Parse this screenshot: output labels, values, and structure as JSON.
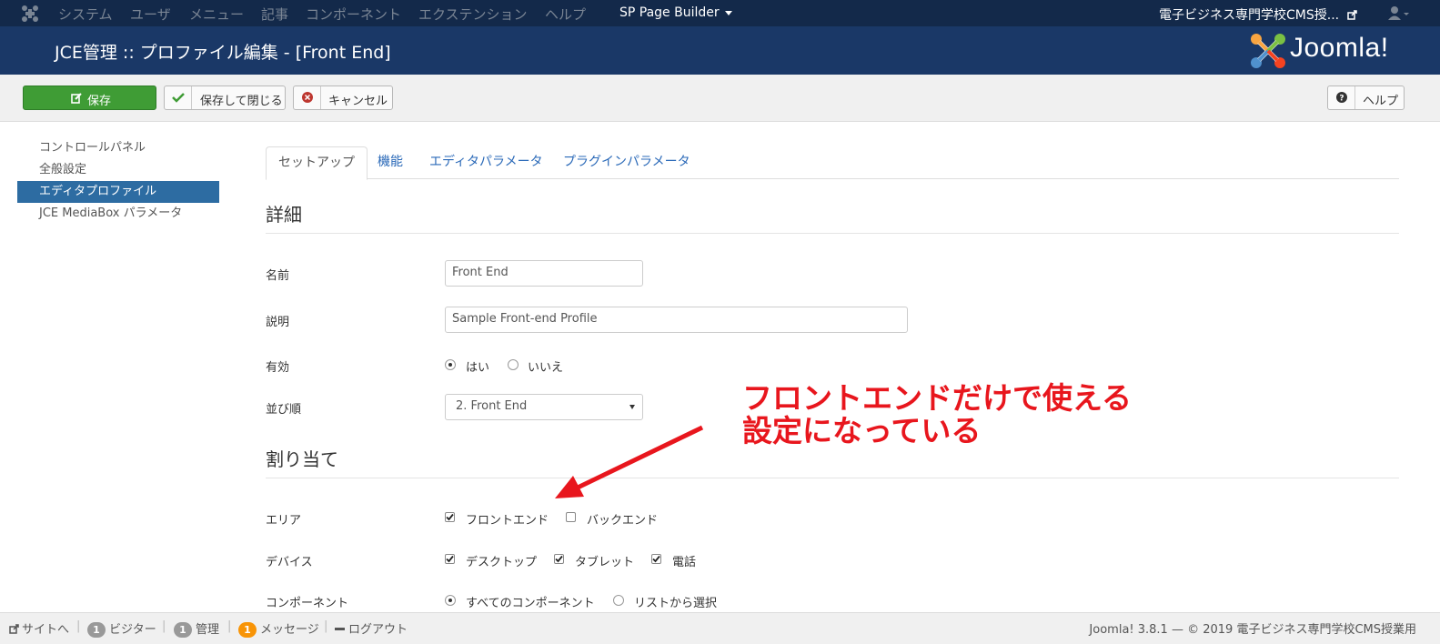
{
  "topnav": {
    "menu": [
      "システム",
      "ユーザ",
      "メニュー",
      "記事",
      "コンポーネント",
      "エクステンション",
      "ヘルプ"
    ],
    "page_builder": "SP Page Builder",
    "site_name": "電子ビジネス専門学校CMS授..."
  },
  "header": {
    "title": "JCE管理 :: プロファイル編集 - [Front End]",
    "logo_text": "Joomla!"
  },
  "toolbar": {
    "save": "保存",
    "save_close": "保存して閉じる",
    "cancel": "キャンセル",
    "help": "ヘルプ"
  },
  "sidebar": {
    "items": [
      "コントロールパネル",
      "全般設定",
      "エディタプロファイル",
      "JCE MediaBox パラメータ"
    ],
    "active_index": 2
  },
  "tabs": [
    "セットアップ",
    "機能",
    "エディタパラメータ",
    "プラグインパラメータ"
  ],
  "details": {
    "heading": "詳細",
    "name_label": "名前",
    "name_value": "Front End",
    "desc_label": "説明",
    "desc_value": "Sample Front-end Profile",
    "enabled_label": "有効",
    "enabled_yes": "はい",
    "enabled_no": "いいえ",
    "enabled_value": "はい",
    "order_label": "並び順",
    "order_value": "2. Front End"
  },
  "assignment": {
    "heading": "割り当て",
    "area_label": "エリア",
    "area_front": "フロントエンド",
    "area_back": "バックエンド",
    "area_front_checked": true,
    "area_back_checked": false,
    "device_label": "デバイス",
    "device_desktop": "デスクトップ",
    "device_tablet": "タブレット",
    "device_phone": "電話",
    "component_label": "コンポーネント",
    "component_all": "すべてのコンポーネント",
    "component_list": "リストから選択"
  },
  "annotation": {
    "line1": "フロントエンドだけで使える",
    "line2": "設定になっている",
    "color": "#e8161d"
  },
  "status": {
    "site": "サイトへ",
    "visitors_count": "1",
    "visitors": "ビジター",
    "admin_count": "1",
    "admin": "管理",
    "messages_count": "1",
    "messages": "メッセージ",
    "logout": "ログアウト",
    "footer": "Joomla! 3.8.1 — © 2019 電子ビジネス専門学校CMS授業用"
  },
  "colors": {
    "topnav_bg": "#13294a",
    "header_bg": "#1a3867",
    "save_green": "#3f9c35",
    "sidebar_active": "#2d6ca2",
    "link_blue": "#2a69b8"
  }
}
